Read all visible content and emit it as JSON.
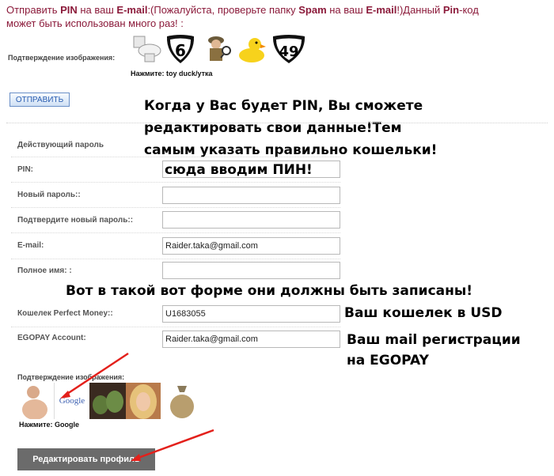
{
  "top": {
    "line1_parts": [
      "Отправить ",
      "PIN",
      " на ваш ",
      "E-mail",
      ":(Пожалуйста, проверьте папку ",
      "Spam",
      " на ваш ",
      "E-mail",
      "!)Данный ",
      "Pin",
      "-код"
    ],
    "line2": "может быть использован много раз! :"
  },
  "captcha1": {
    "label": "Подтверждение изображения:",
    "hint": "Нажмите: toy duck/утка",
    "images": [
      "toilet-icon",
      "highway-6-sign",
      "detective-icon",
      "rubber-duck-icon",
      "highway-49-sign"
    ],
    "sign_numbers": [
      "6",
      "49"
    ]
  },
  "send_button": "ОТПРАВИТЬ",
  "annotations": {
    "note1": "Когда у Вас будет PIN, Вы сможете",
    "note2": "редактировать свои данные!Тем",
    "note3": "самым указать правильно кошельки!",
    "note4": "сюда вводим ПИН!",
    "note5": "Вот в такой вот форме они должны быть записаны!",
    "note6": "Ваш кошелек в USD",
    "note7": "Ваш mail регистрации",
    "note8": "на EGOPAY"
  },
  "form": {
    "current_password": "Действующий пароль",
    "pin": "PIN:",
    "new_password": "Новый пароль::",
    "confirm_password": "Подтвердите новый пароль::",
    "email": "E-mail:",
    "email_value": "Raider.taka@gmail.com",
    "full_name": "Полное имя:",
    "full_name_suffix": ":",
    "perfect_money": "Кошелек Perfect Money::",
    "perfect_money_value": "U1683055",
    "egopay": "EGOPAY Account:",
    "egopay_value": "Raider.taka@gmail.com"
  },
  "captcha2": {
    "label": "Подтверждение изображения:",
    "hint": "Нажмите: Google",
    "google_text": "Google",
    "images": [
      "man-photo",
      "google-logo",
      "cactus-photo",
      "woman-photo",
      "money-bag-icon"
    ]
  },
  "edit_button": "Редактировать профиль",
  "colors": {
    "heading_red": "#8b1a3a",
    "arrow_red": "#e3201b",
    "button_gray": "#6b6b6b"
  }
}
